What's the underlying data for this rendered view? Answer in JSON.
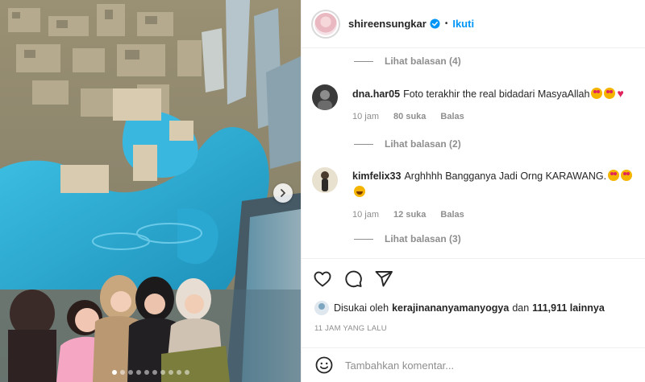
{
  "post": {
    "username": "shireensungkar",
    "separator": "•",
    "follow_label": "Ikuti",
    "carousel_total": 10,
    "carousel_active": 0
  },
  "comments": {
    "replies_1": "Lihat balasan (4)",
    "items": [
      {
        "username": "dna.har05",
        "text": "Foto terakhir the real bidadari MasyaAllah",
        "time": "10 jam",
        "likes": "80 suka",
        "reply_label": "Balas",
        "view_replies": "Lihat balasan (2)"
      },
      {
        "username": "kimfelix33",
        "text": "Arghhhh Bangganya Jadi Orng KARAWANG.",
        "time": "10 jam",
        "likes": "12 suka",
        "reply_label": "Balas",
        "view_replies": "Lihat balasan (3)"
      }
    ]
  },
  "likes": {
    "prefix": "Disukai oleh",
    "user": "kerajinananyamanyogya",
    "conj": "dan",
    "count": "111,911 lainnya"
  },
  "time_ago": "11 JAM YANG LALU",
  "add_comment": {
    "placeholder": "Tambahkan komentar..."
  },
  "icons": {
    "like": "heart-outline-icon",
    "comment": "comment-bubble-icon",
    "share": "paper-plane-icon",
    "emoji": "smiley-icon",
    "verified": "verified-badge-icon",
    "next": "chevron-right-icon"
  },
  "colors": {
    "accent": "#0095f6",
    "verified": "#0095f6",
    "text": "#262626",
    "muted": "#8e8e8e"
  }
}
